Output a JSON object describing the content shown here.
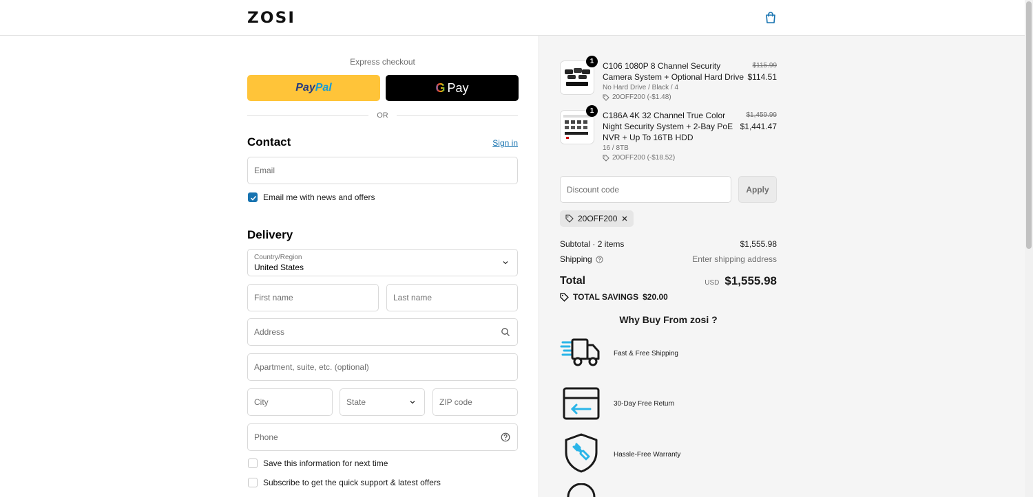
{
  "header": {
    "logo": "ZOSI",
    "cart_icon": "shopping-bag-icon"
  },
  "express": {
    "label": "Express checkout",
    "paypal_part1": "Pay",
    "paypal_part2": "Pal",
    "gpay_g": "G",
    "gpay_label": "Pay",
    "or": "OR"
  },
  "contact": {
    "title": "Contact",
    "signin": "Sign in",
    "email_placeholder": "Email",
    "newsletter_label": "Email me with news and offers",
    "newsletter_checked": true
  },
  "delivery": {
    "title": "Delivery",
    "country_label": "Country/Region",
    "country_value": "United States",
    "first_name": "First name",
    "last_name": "Last name",
    "address": "Address",
    "apartment": "Apartment, suite, etc. (optional)",
    "city": "City",
    "state": "State",
    "zip": "ZIP code",
    "phone": "Phone",
    "save_info": "Save this information for next time",
    "subscribe": "Subscribe to get the quick support & latest offers"
  },
  "order": {
    "items": [
      {
        "qty": "1",
        "name": "C106 1080P 8 Channel Security Camera System + Optional Hard Drive",
        "variant": "No Hard Drive / Black / 4",
        "discount": "20OFF200 (-$1.48)",
        "old_price": "$115.99",
        "price": "$114.51"
      },
      {
        "qty": "1",
        "name": "C186A 4K 32 Channel True Color Night Security System + 2-Bay PoE NVR + Up To 16TB HDD",
        "variant": "16 / 8TB",
        "discount": "20OFF200 (-$18.52)",
        "old_price": "$1,459.99",
        "price": "$1,441.47"
      }
    ],
    "discount_placeholder": "Discount code",
    "apply": "Apply",
    "applied_code": "20OFF200",
    "subtotal_label": "Subtotal · 2 items",
    "subtotal_value": "$1,555.98",
    "shipping_label": "Shipping",
    "shipping_value": "Enter shipping address",
    "total_label": "Total",
    "total_currency": "USD",
    "total_value": "$1,555.98",
    "savings_label": "TOTAL SAVINGS",
    "savings_value": "$20.00"
  },
  "why": {
    "title": "Why Buy From zosi ?",
    "features": [
      {
        "label": "Fast & Free Shipping",
        "icon": "truck-icon"
      },
      {
        "label": "30-Day Free Return",
        "icon": "return-box-icon"
      },
      {
        "label": "Hassle-Free Warranty",
        "icon": "wrench-shield-icon"
      }
    ]
  },
  "colors": {
    "accent": "#1773b0",
    "paypal": "#ffc439",
    "icon_blue": "#2bb5e8"
  }
}
